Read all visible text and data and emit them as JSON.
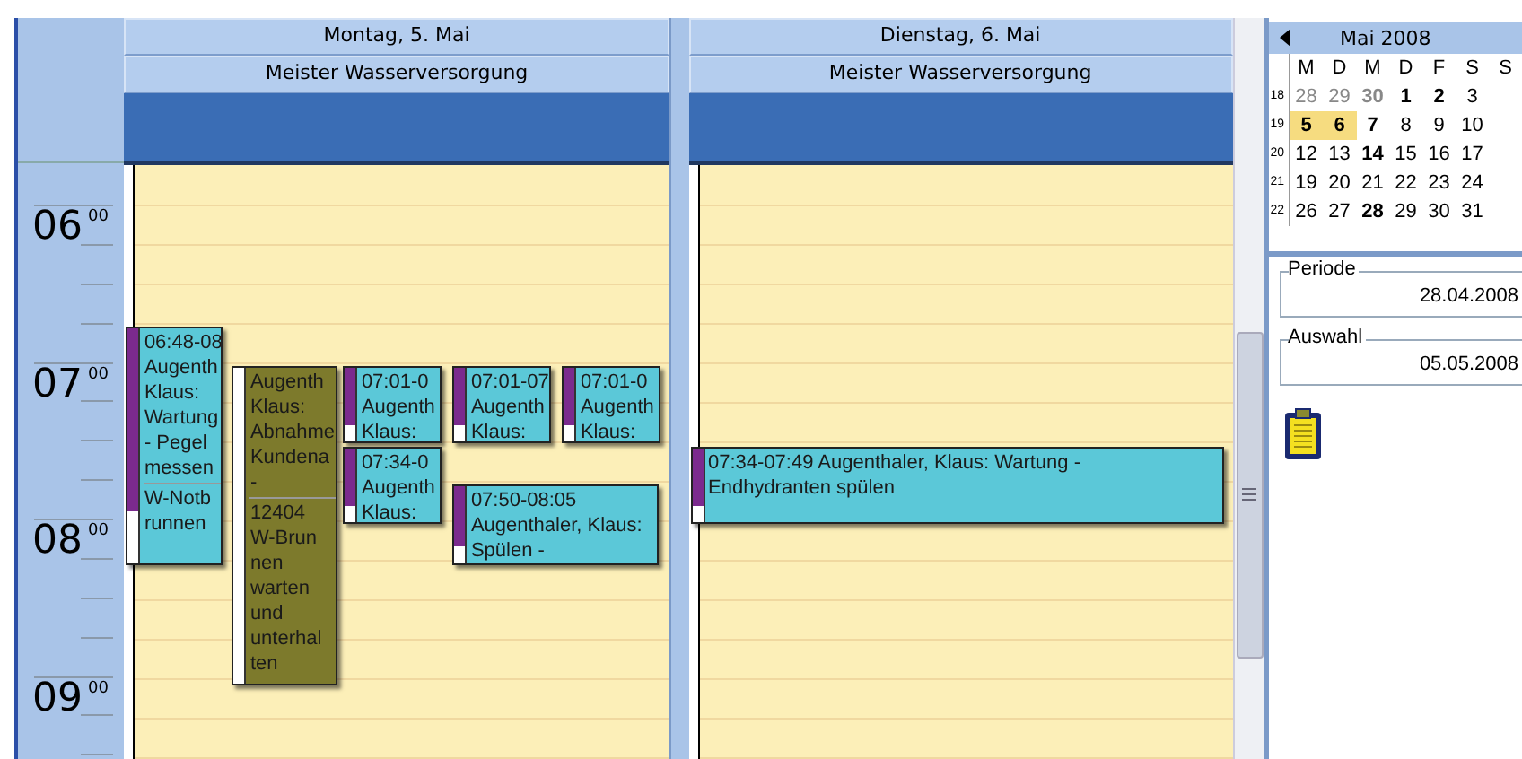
{
  "time_ruler": [
    {
      "hour": "06",
      "minutes": "00"
    },
    {
      "hour": "07",
      "minutes": "00"
    },
    {
      "hour": "08",
      "minutes": "00"
    },
    {
      "hour": "09",
      "minutes": "00"
    }
  ],
  "days": [
    {
      "title": "Montag, 5. Mai",
      "resource": "Meister Wasserversorgung",
      "events": [
        {
          "color": "#5bc8d8",
          "busy": true,
          "lines": [
            "06:48-08",
            "Augenth",
            "Klaus:",
            "Wartung",
            "- Pegel",
            "messen"
          ],
          "detail_lines": [
            "W-Notb",
            "runnen"
          ]
        },
        {
          "color": "#7d7a2c",
          "busy": false,
          "lines": [
            "Augenth",
            "Klaus:",
            "Abnahme",
            "Kundena",
            "-"
          ],
          "detail_lines": [
            "12404",
            "W-Brun",
            "nen",
            "warten",
            "und",
            "unterhal",
            "ten"
          ]
        },
        {
          "color": "#5bc8d8",
          "busy": true,
          "lines": [
            "07:01-0",
            "Augenth",
            "Klaus:"
          ]
        },
        {
          "color": "#5bc8d8",
          "busy": true,
          "lines": [
            "07:34-0",
            "Augenth",
            "Klaus:"
          ]
        },
        {
          "color": "#5bc8d8",
          "busy": true,
          "lines": [
            "07:01-07",
            "Augenth",
            "Klaus:"
          ]
        },
        {
          "color": "#5bc8d8",
          "busy": true,
          "lines": [
            "07:01-0",
            "Augenth",
            "Klaus:"
          ]
        },
        {
          "color": "#5bc8d8",
          "busy": true,
          "lines": [
            "07:50-08:05",
            "Augenthaler, Klaus:",
            "Spülen -"
          ]
        }
      ]
    },
    {
      "title": "Dienstag, 6. Mai",
      "resource": "Meister Wasserversorgung",
      "events": [
        {
          "color": "#5bc8d8",
          "busy": true,
          "lines": [
            "07:34-07:49 Augenthaler, Klaus: Wartung -",
            "Endhydranten spülen"
          ]
        }
      ]
    }
  ],
  "mini_calendar": {
    "title": "Mai 2008",
    "weekdays": [
      "M",
      "D",
      "M",
      "D",
      "F",
      "S",
      "S"
    ],
    "weeks": [
      {
        "number": "18",
        "days": [
          {
            "day": "28",
            "bold": false,
            "muted": true,
            "selected": false
          },
          {
            "day": "29",
            "bold": false,
            "muted": true,
            "selected": false
          },
          {
            "day": "30",
            "bold": true,
            "muted": true,
            "selected": false
          },
          {
            "day": "1",
            "bold": true,
            "muted": false,
            "selected": false
          },
          {
            "day": "2",
            "bold": true,
            "muted": false,
            "selected": false
          },
          {
            "day": "3",
            "bold": false,
            "muted": false,
            "selected": false
          }
        ]
      },
      {
        "number": "19",
        "days": [
          {
            "day": "5",
            "bold": true,
            "muted": false,
            "selected": true
          },
          {
            "day": "6",
            "bold": true,
            "muted": false,
            "selected": true
          },
          {
            "day": "7",
            "bold": true,
            "muted": false,
            "selected": false
          },
          {
            "day": "8",
            "bold": false,
            "muted": false,
            "selected": false
          },
          {
            "day": "9",
            "bold": false,
            "muted": false,
            "selected": false
          },
          {
            "day": "10",
            "bold": false,
            "muted": false,
            "selected": false
          }
        ]
      },
      {
        "number": "20",
        "days": [
          {
            "day": "12",
            "bold": false,
            "muted": false,
            "selected": false
          },
          {
            "day": "13",
            "bold": false,
            "muted": false,
            "selected": false
          },
          {
            "day": "14",
            "bold": true,
            "muted": false,
            "selected": false
          },
          {
            "day": "15",
            "bold": false,
            "muted": false,
            "selected": false
          },
          {
            "day": "16",
            "bold": false,
            "muted": false,
            "selected": false
          },
          {
            "day": "17",
            "bold": false,
            "muted": false,
            "selected": false
          }
        ]
      },
      {
        "number": "21",
        "days": [
          {
            "day": "19",
            "bold": false,
            "muted": false,
            "selected": false
          },
          {
            "day": "20",
            "bold": false,
            "muted": false,
            "selected": false
          },
          {
            "day": "21",
            "bold": false,
            "muted": false,
            "selected": false
          },
          {
            "day": "22",
            "bold": false,
            "muted": false,
            "selected": false
          },
          {
            "day": "23",
            "bold": false,
            "muted": false,
            "selected": false
          },
          {
            "day": "24",
            "bold": false,
            "muted": false,
            "selected": false
          }
        ]
      },
      {
        "number": "22",
        "days": [
          {
            "day": "26",
            "bold": false,
            "muted": false,
            "selected": false
          },
          {
            "day": "27",
            "bold": false,
            "muted": false,
            "selected": false
          },
          {
            "day": "28",
            "bold": true,
            "muted": false,
            "selected": false
          },
          {
            "day": "29",
            "bold": false,
            "muted": false,
            "selected": false
          },
          {
            "day": "30",
            "bold": false,
            "muted": false,
            "selected": false
          },
          {
            "day": "31",
            "bold": false,
            "muted": false,
            "selected": false
          }
        ]
      }
    ]
  },
  "periode": {
    "label": "Periode",
    "value": "28.04.2008"
  },
  "auswahl": {
    "label": "Auswahl",
    "value": "05.05.2008"
  }
}
